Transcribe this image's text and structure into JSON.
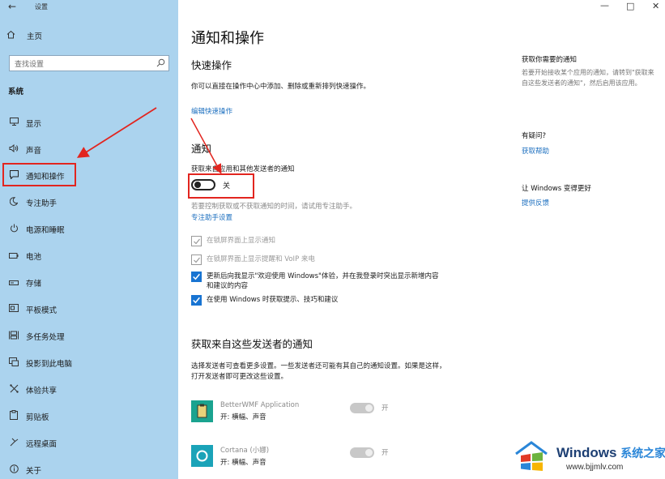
{
  "window": {
    "app_title": "设置",
    "back_glyph": "←",
    "minimize_glyph": "—",
    "maximize_glyph": "□",
    "close_glyph": "✕"
  },
  "sidebar": {
    "home_label": "主页",
    "search_placeholder": "查找设置",
    "section_label": "系统",
    "items": [
      {
        "label": "显示",
        "icon": "display-icon"
      },
      {
        "label": "声音",
        "icon": "sound-icon"
      },
      {
        "label": "通知和操作",
        "icon": "notification-icon"
      },
      {
        "label": "专注助手",
        "icon": "moon-icon"
      },
      {
        "label": "电源和睡眠",
        "icon": "power-icon"
      },
      {
        "label": "电池",
        "icon": "battery-icon"
      },
      {
        "label": "存储",
        "icon": "storage-icon"
      },
      {
        "label": "平板模式",
        "icon": "tablet-icon"
      },
      {
        "label": "多任务处理",
        "icon": "multitask-icon"
      },
      {
        "label": "投影到此电脑",
        "icon": "project-icon"
      },
      {
        "label": "体验共享",
        "icon": "share-icon"
      },
      {
        "label": "剪贴板",
        "icon": "clipboard-icon"
      },
      {
        "label": "远程桌面",
        "icon": "remote-desktop-icon"
      },
      {
        "label": "关于",
        "icon": "info-icon"
      }
    ]
  },
  "main": {
    "title": "通知和操作",
    "quick_actions": {
      "heading": "快速操作",
      "desc": "你可以直接在操作中心中添加、删除或重新排列快速操作。",
      "edit_link": "编辑快速操作"
    },
    "notifications": {
      "heading": "通知",
      "toggle_caption": "获取来自应用和其他发送者的通知",
      "toggle_state": "关",
      "focus_desc": "若要控制获取或不获取通知的时间，请试用专注助手。",
      "focus_link": "专注助手设置",
      "checkboxes": [
        {
          "label": "在锁屏界面上显示通知",
          "checked": true,
          "enabled": false
        },
        {
          "label": "在锁屏界面上显示提醒和 VoIP 来电",
          "checked": true,
          "enabled": false
        },
        {
          "label": "更新后向我显示\"欢迎使用 Windows\"体验，并在我登录时突出显示新增内容和建议的内容",
          "checked": true,
          "enabled": true
        },
        {
          "label": "在使用 Windows 时获取提示、技巧和建议",
          "checked": true,
          "enabled": true
        }
      ]
    },
    "senders": {
      "heading": "获取来自这些发送者的通知",
      "desc": "选择发送者可查看更多设置。一些发送者还可能有其自己的通知设置。如果是这样，打开发送者即可更改这些设置。",
      "items": [
        {
          "name": "BetterWMF Application",
          "status": "开: 横幅、声音",
          "switch_label": "开"
        },
        {
          "name": "Cortana (小娜)",
          "status": "开: 横幅、声音",
          "switch_label": "开"
        }
      ]
    }
  },
  "right": {
    "apps_heading": "获取你需要的通知",
    "apps_desc": "若要开始接收某个应用的通知，请转到\"获取来自这些发送者的通知\"，然后启用该应用。",
    "question_heading": "有疑问?",
    "help_link": "获取帮助",
    "improve_heading": "让 Windows 变得更好",
    "feedback_link": "提供反馈"
  },
  "watermark": {
    "brand": "Windows",
    "brand_cn": "系统之家",
    "url": "www.bjjmlv.com"
  },
  "colors": {
    "sidebar_bg": "#abd3ee",
    "accent": "#1874d2",
    "link": "#1c6fbf",
    "annotation_red": "#e2251f"
  }
}
